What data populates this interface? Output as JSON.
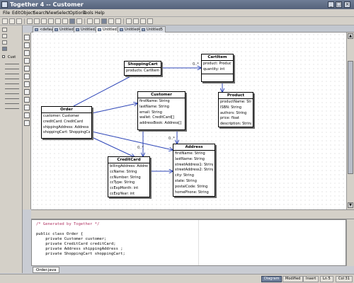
{
  "window": {
    "title": "Together 4 -- Customer"
  },
  "menubar": {
    "items": [
      "File",
      "Edit",
      "Object",
      "Search",
      "View",
      "Select",
      "Options",
      "Tools",
      "Help"
    ]
  },
  "tabs": [
    {
      "label": "<default>",
      "active": false
    },
    {
      "label": "Untitled1",
      "active": false
    },
    {
      "label": "Untitled2",
      "active": false
    },
    {
      "label": "Untitled3",
      "active": true
    },
    {
      "label": "Untitled4",
      "active": false
    },
    {
      "label": "Untitled5",
      "active": false
    }
  ],
  "explorer": {
    "root_label": "Cust"
  },
  "classes": {
    "shoppingcart": {
      "name": "ShoppingCart",
      "attributes": [
        "products: CartItem[]"
      ]
    },
    "cartitem": {
      "name": "CartItem",
      "attributes": [
        "product: Product",
        "quantity: int"
      ]
    },
    "product": {
      "name": "Product",
      "attributes": [
        "productName: String",
        "ISBN: String",
        "authors: String",
        "price: float",
        "description: String"
      ]
    },
    "order": {
      "name": "Order",
      "attributes": [
        "customer: Customer",
        "creditCard: CreditCard",
        "shippingAddress: Address",
        "shoppingCart: ShoppingCart"
      ]
    },
    "customer": {
      "name": "Customer",
      "attributes": [
        "firstName: String",
        "lastName: String",
        "email: String",
        "wallet: CreditCard[]",
        "addressBook: Address[]"
      ]
    },
    "creditcard": {
      "name": "CreditCard",
      "attributes": [
        "billingAddress: Address",
        "ccName: String",
        "ccNumber: String",
        "ccType: String",
        "ccExpMonth: int",
        "ccExpYear: int"
      ]
    },
    "address": {
      "name": "Address",
      "attributes": [
        "firstName: String",
        "lastName: String",
        "streetAddress1: String",
        "streetAddress2: String",
        "city: String",
        "state: String",
        "postalCode: String",
        "homePhone: String"
      ]
    }
  },
  "multiplicities": {
    "cart_to_item": "0..*",
    "customer_to_card": "0..*",
    "customer_to_address": "0..*"
  },
  "editor": {
    "lines": [
      "/* Generated by Together */",
      "",
      "public class Order {",
      "    private Customer customer;",
      "    private CreditCard creditCard;",
      "    private Address shippingAddress ;",
      "    private ShoppingCart shoppingCart;"
    ]
  },
  "file_tab": "Order.java",
  "status": {
    "mode": "Diagram",
    "modified": "Modified",
    "insert": "Insert",
    "line": "Ln 5",
    "col": "Col 31"
  }
}
